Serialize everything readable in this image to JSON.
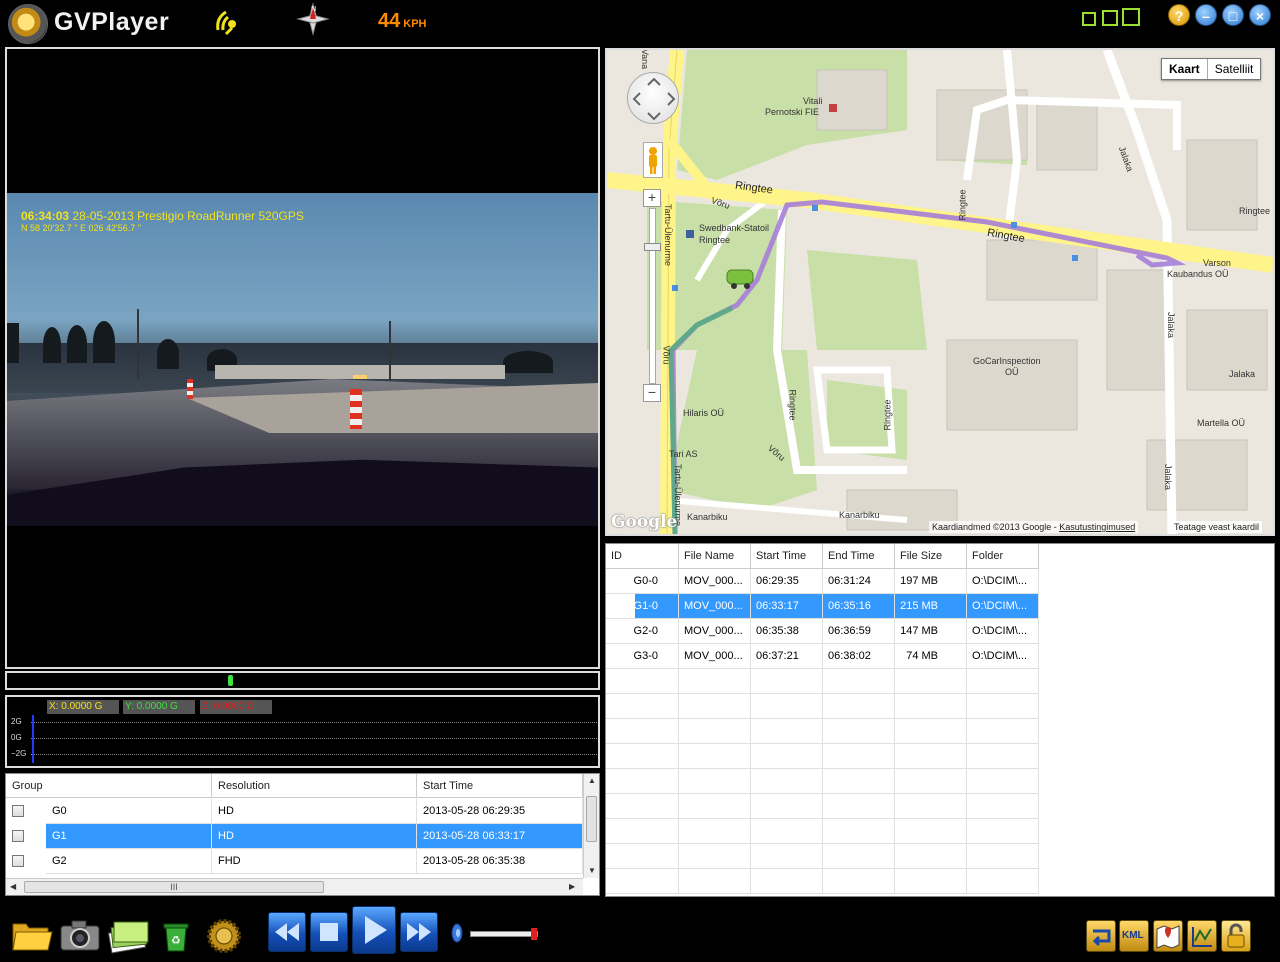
{
  "app": {
    "title": "GVPlayer",
    "speed_value": "44",
    "speed_unit": "KPH"
  },
  "window_controls": {
    "help_label": "?",
    "minimize_label": "–",
    "maximize_label": "□",
    "close_label": "×"
  },
  "video": {
    "osd_time": "06:34:03",
    "osd_info": "28-05-2013 Prestigio RoadRunner 520GPS",
    "osd_coords": "N 58 20'32.7 \"  E  026 42'56.7 \""
  },
  "gsensor": {
    "x_readout": "X: 0.0000 G",
    "y_readout": "Y: 0.0000 G",
    "z_readout": "Z: 0.0000 G",
    "axis_top": "2G",
    "axis_mid": "0G",
    "axis_bottom": "−2G"
  },
  "group_table": {
    "headers": [
      "Group",
      "Resolution",
      "Start Time"
    ],
    "rows": [
      {
        "group": "G0",
        "resolution": "HD",
        "start": "2013-05-28 06:29:35"
      },
      {
        "group": "G1",
        "resolution": "HD",
        "start": "2013-05-28 06:33:17"
      },
      {
        "group": "G2",
        "resolution": "FHD",
        "start": "2013-05-28 06:35:38"
      }
    ],
    "selected_index": 1
  },
  "map": {
    "map_type_map": "Kaart",
    "map_type_satellite": "Satelliit",
    "attribution": "Kaardiandmed ©2013 Google - ",
    "terms_link": "Kasutustingimused",
    "report_link": "Teatage veast kaardil",
    "logo": "Google",
    "zoom_in_label": "+",
    "zoom_out_label": "−",
    "labels": {
      "vitali": "Vitali",
      "pernotski": "Pernotski FIE",
      "ringtee1": "Ringtee",
      "ringtee2": "Ringtee",
      "ringtee_small1": "Ringtee",
      "ringtee_small2": "Ringtee",
      "ringtee_small3": "Ringtee",
      "ringtee_right": "Ringtee",
      "voru1": "Võru",
      "voru2": "Võru",
      "voru3": "Võru",
      "tartu1": "Tartu-Ülenurme",
      "tartu2": "Tartu-Ülenurme",
      "swedbank": "Swedbank-Statoil",
      "swedbank2": "Ringtee",
      "jalaka1": "Jalaka",
      "jalaka2": "Jalaka",
      "jalaka3": "Jalaka",
      "jalaka4": "Jalaka",
      "varson1": "Varson",
      "varson2": "Kaubandus OÜ",
      "gocar1": "GoCarInspection",
      "gocar2": "OÜ",
      "hilaris": "Hilaris OÜ",
      "tari": "Tari AS",
      "martella": "Martella OÜ",
      "kanarbiku1": "Kanarbiku",
      "kanarbiku2": "Kanarbiku",
      "vana": "Vana"
    }
  },
  "file_table": {
    "headers": [
      "ID",
      "File Name",
      "Start Time",
      "End Time",
      "File Size",
      "Folder"
    ],
    "rows": [
      {
        "id": "G0-0",
        "name": "MOV_000...",
        "start": "06:29:35",
        "end": "06:31:24",
        "size": "197 MB",
        "folder": "O:\\DCIM\\..."
      },
      {
        "id": "G1-0",
        "name": "MOV_000...",
        "start": "06:33:17",
        "end": "06:35:16",
        "size": "215 MB",
        "folder": "O:\\DCIM\\..."
      },
      {
        "id": "G2-0",
        "name": "MOV_000...",
        "start": "06:35:38",
        "end": "06:36:59",
        "size": "147 MB",
        "folder": "O:\\DCIM\\..."
      },
      {
        "id": "G3-0",
        "name": "MOV_000...",
        "start": "06:37:21",
        "end": "06:38:02",
        "size": "74 MB",
        "folder": "O:\\DCIM\\..."
      }
    ],
    "selected_index": 1
  },
  "toolbar": {
    "kml_label": "KML",
    "hscroll_grip": "III"
  },
  "colors": {
    "selection": "#3399ff",
    "speed": "#ff8c00",
    "osd": "#f2e21c",
    "route_past": "#5fa88a",
    "route_current": "#a67ed8",
    "main_road": "#fef48a"
  }
}
